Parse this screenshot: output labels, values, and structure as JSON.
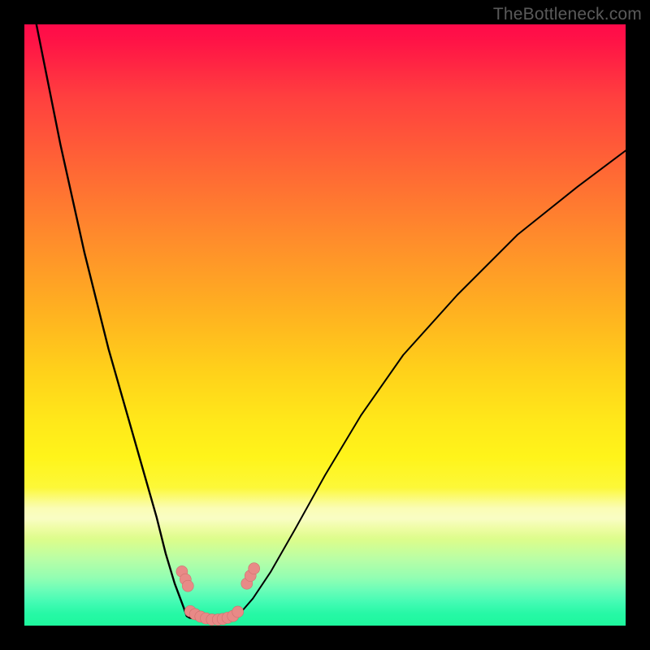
{
  "watermark": "TheBottleneck.com",
  "colors": {
    "frame": "#000000",
    "curve_stroke": "#000000",
    "marker_fill": "#e88a87",
    "marker_stroke": "#cf6f6e"
  },
  "chart_data": {
    "type": "line",
    "title": "",
    "xlabel": "",
    "ylabel": "",
    "xlim": [
      0,
      100
    ],
    "ylim": [
      0,
      100
    ],
    "series": [
      {
        "name": "left-curve",
        "x": [
          2,
          4,
          6,
          8,
          10,
          12,
          14,
          16,
          18,
          20,
          22,
          23.5,
          25,
          26.5,
          27,
          27.5
        ],
        "y": [
          100,
          90,
          80,
          71,
          62,
          54,
          46,
          39,
          32,
          25,
          18,
          12,
          7,
          3,
          1.6,
          1.3
        ]
      },
      {
        "name": "bottom-curve",
        "x": [
          27.5,
          28.5,
          30,
          32,
          33.5,
          34.5,
          35
        ],
        "y": [
          1.3,
          1.1,
          1.0,
          1.0,
          1.1,
          1.3,
          1.5
        ]
      },
      {
        "name": "right-curve",
        "x": [
          35,
          36,
          38,
          41,
          45,
          50,
          56,
          63,
          72,
          82,
          92,
          100
        ],
        "y": [
          1.5,
          2.2,
          4.5,
          9,
          16,
          25,
          35,
          45,
          55,
          65,
          73,
          79
        ]
      }
    ],
    "markers": [
      {
        "name": "cluster-left-upper-1",
        "x": 26.2,
        "y": 9.0
      },
      {
        "name": "cluster-left-upper-2",
        "x": 26.8,
        "y": 7.7
      },
      {
        "name": "cluster-left-upper-3",
        "x": 27.2,
        "y": 6.6
      },
      {
        "name": "cluster-left-lower-1",
        "x": 27.6,
        "y": 2.4
      },
      {
        "name": "cluster-left-lower-2",
        "x": 28.4,
        "y": 1.9
      },
      {
        "name": "cluster-left-lower-3",
        "x": 29.3,
        "y": 1.5
      },
      {
        "name": "cluster-mid-1",
        "x": 30.2,
        "y": 1.2
      },
      {
        "name": "cluster-mid-2",
        "x": 31.2,
        "y": 1.0
      },
      {
        "name": "cluster-mid-3",
        "x": 32.2,
        "y": 1.0
      },
      {
        "name": "cluster-mid-4",
        "x": 33.0,
        "y": 1.1
      },
      {
        "name": "cluster-mid-5",
        "x": 33.8,
        "y": 1.3
      },
      {
        "name": "cluster-right-lower-1",
        "x": 34.7,
        "y": 1.6
      },
      {
        "name": "cluster-right-lower-2",
        "x": 35.5,
        "y": 2.3
      },
      {
        "name": "cluster-right-upper-1",
        "x": 37.0,
        "y": 7.0
      },
      {
        "name": "cluster-right-upper-2",
        "x": 37.6,
        "y": 8.3
      },
      {
        "name": "cluster-right-upper-3",
        "x": 38.2,
        "y": 9.5
      }
    ],
    "legend": false
  }
}
